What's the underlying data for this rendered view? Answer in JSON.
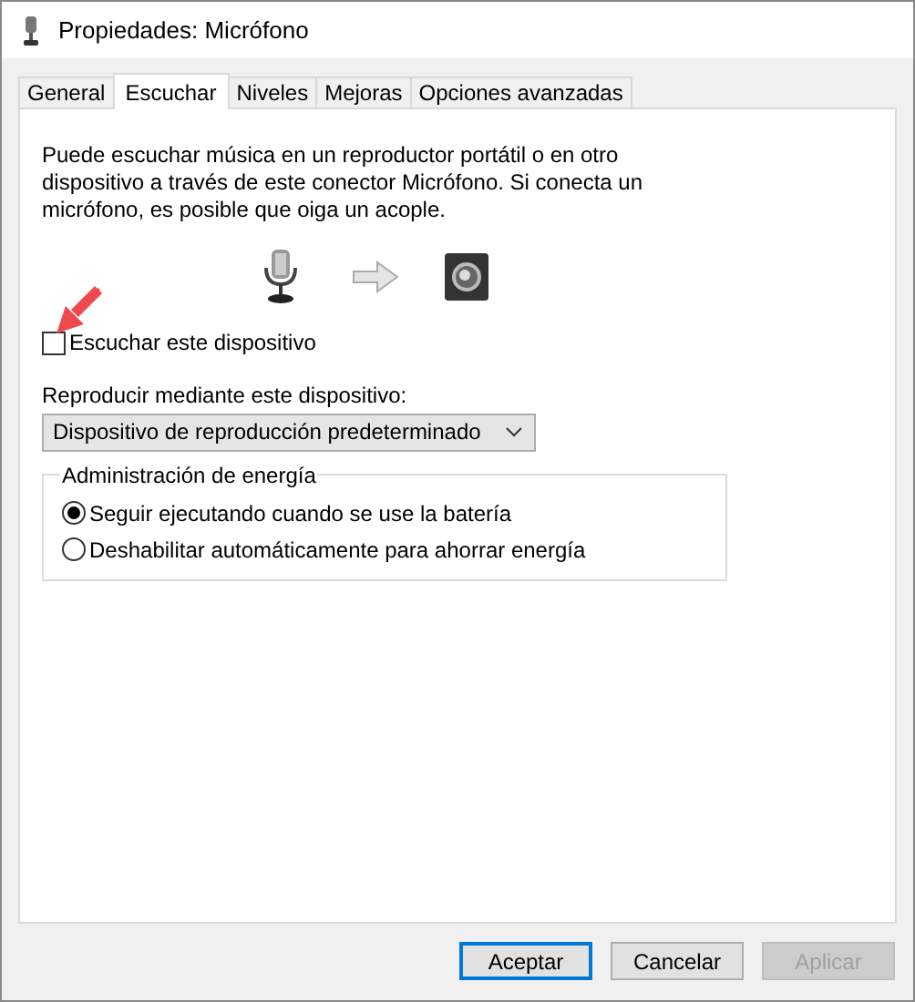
{
  "window": {
    "title": "Propiedades: Micrófono"
  },
  "tabs": [
    {
      "label": "General",
      "selected": false
    },
    {
      "label": "Escuchar",
      "selected": true
    },
    {
      "label": "Niveles",
      "selected": false
    },
    {
      "label": "Mejoras",
      "selected": false
    },
    {
      "label": "Opciones avanzadas",
      "selected": false
    }
  ],
  "description": "Puede escuchar música en un reproductor portátil o en otro dispositivo a través de este conector Micrófono. Si conecta un micrófono, es posible que oiga un acople.",
  "listen_checkbox": {
    "label": "Escuchar este dispositivo",
    "checked": false
  },
  "playback": {
    "label": "Reproducir mediante este dispositivo:",
    "value": "Dispositivo de reproducción predeterminado"
  },
  "power": {
    "title": "Administración de energía",
    "options": [
      {
        "label": "Seguir ejecutando cuando se use la batería",
        "selected": true
      },
      {
        "label": "Deshabilitar automáticamente para ahorrar energía",
        "selected": false
      }
    ]
  },
  "buttons": [
    {
      "label": "Aceptar",
      "kind": "default",
      "disabled": false
    },
    {
      "label": "Cancelar",
      "kind": "normal",
      "disabled": false
    },
    {
      "label": "Aplicar",
      "kind": "normal",
      "disabled": true
    }
  ]
}
